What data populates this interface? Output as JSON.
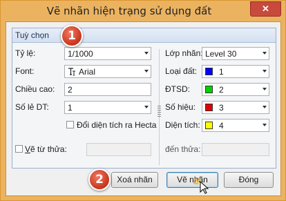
{
  "window": {
    "title": "Vẽ nhãn hiện trạng sử dụng đất",
    "close_glyph": "✕"
  },
  "group": {
    "title": "Tuỳ chọn"
  },
  "badges": {
    "first": "1",
    "second": "2"
  },
  "left": {
    "scale": {
      "label": "Tỷ lệ:",
      "value": "1/1000"
    },
    "font": {
      "label": "Font:",
      "value": "Arial",
      "icon": "font-type-icon"
    },
    "height": {
      "label": "Chiều cao:",
      "value": "2"
    },
    "decimals": {
      "label": "Số lẻ DT:",
      "value": "1"
    },
    "hecta": {
      "label": "Đổi diện tích ra Hecta",
      "checked": false
    },
    "from_parcel": {
      "label_prefix": "V",
      "label_rest": "ẽ từ thửa:",
      "checked": false,
      "value": ""
    }
  },
  "right": {
    "layer": {
      "label": "Lớp nhãn:",
      "value": "Level 30"
    },
    "land_type": {
      "label": "Loại đất:",
      "value": "1",
      "color": "#0000ff"
    },
    "land_use": {
      "label": "ĐTSD:",
      "value": "2",
      "color": "#00d000"
    },
    "number": {
      "label": "Số hiệu:",
      "value": "3",
      "color": "#e00000"
    },
    "area": {
      "label": "Diện tích:",
      "value": "4",
      "color": "#ffff00"
    },
    "to_parcel": {
      "label": "đến thửa:",
      "value": ""
    }
  },
  "buttons": {
    "clear": "Xoá nhãn",
    "draw": "Vẽ nhãn",
    "close": "Đóng"
  }
}
